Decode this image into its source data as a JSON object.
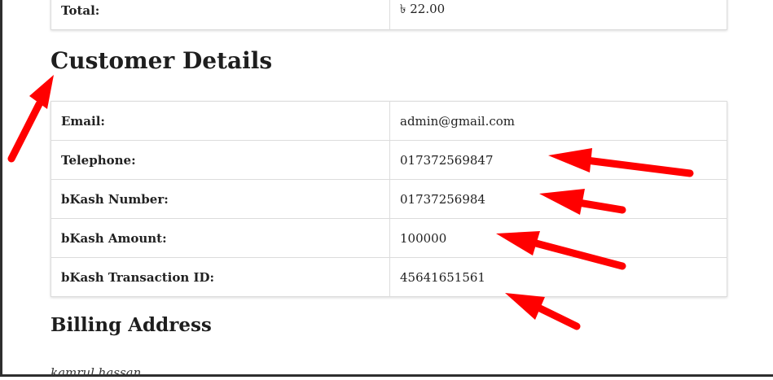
{
  "order_totals": {
    "total_label": "Total:",
    "total_value": "৳ 22.00"
  },
  "customer_details": {
    "heading": "Customer Details",
    "rows": [
      {
        "label": "Email:",
        "value": "admin@gmail.com"
      },
      {
        "label": "Telephone:",
        "value": "017372569847"
      },
      {
        "label": "bKash Number:",
        "value": "01737256984"
      },
      {
        "label": "bKash Amount:",
        "value": "100000"
      },
      {
        "label": "bKash Transaction ID:",
        "value": "45641651561"
      }
    ]
  },
  "billing_address": {
    "heading": "Billing Address",
    "name": "kamrul hassan"
  },
  "annotations": {
    "arrow_color": "#ff0000"
  }
}
